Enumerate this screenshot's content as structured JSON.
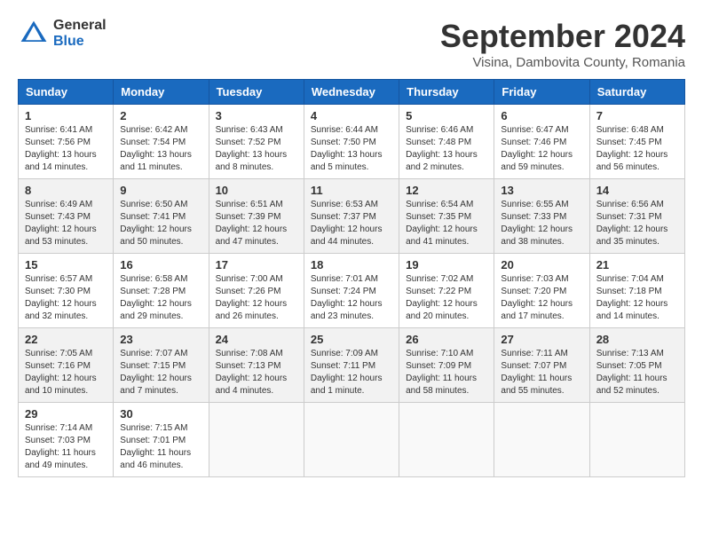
{
  "header": {
    "logo_general": "General",
    "logo_blue": "Blue",
    "title": "September 2024",
    "subtitle": "Visina, Dambovita County, Romania"
  },
  "days_of_week": [
    "Sunday",
    "Monday",
    "Tuesday",
    "Wednesday",
    "Thursday",
    "Friday",
    "Saturday"
  ],
  "weeks": [
    [
      {
        "day": "1",
        "text": "Sunrise: 6:41 AM\nSunset: 7:56 PM\nDaylight: 13 hours and 14 minutes."
      },
      {
        "day": "2",
        "text": "Sunrise: 6:42 AM\nSunset: 7:54 PM\nDaylight: 13 hours and 11 minutes."
      },
      {
        "day": "3",
        "text": "Sunrise: 6:43 AM\nSunset: 7:52 PM\nDaylight: 13 hours and 8 minutes."
      },
      {
        "day": "4",
        "text": "Sunrise: 6:44 AM\nSunset: 7:50 PM\nDaylight: 13 hours and 5 minutes."
      },
      {
        "day": "5",
        "text": "Sunrise: 6:46 AM\nSunset: 7:48 PM\nDaylight: 13 hours and 2 minutes."
      },
      {
        "day": "6",
        "text": "Sunrise: 6:47 AM\nSunset: 7:46 PM\nDaylight: 12 hours and 59 minutes."
      },
      {
        "day": "7",
        "text": "Sunrise: 6:48 AM\nSunset: 7:45 PM\nDaylight: 12 hours and 56 minutes."
      }
    ],
    [
      {
        "day": "8",
        "text": "Sunrise: 6:49 AM\nSunset: 7:43 PM\nDaylight: 12 hours and 53 minutes."
      },
      {
        "day": "9",
        "text": "Sunrise: 6:50 AM\nSunset: 7:41 PM\nDaylight: 12 hours and 50 minutes."
      },
      {
        "day": "10",
        "text": "Sunrise: 6:51 AM\nSunset: 7:39 PM\nDaylight: 12 hours and 47 minutes."
      },
      {
        "day": "11",
        "text": "Sunrise: 6:53 AM\nSunset: 7:37 PM\nDaylight: 12 hours and 44 minutes."
      },
      {
        "day": "12",
        "text": "Sunrise: 6:54 AM\nSunset: 7:35 PM\nDaylight: 12 hours and 41 minutes."
      },
      {
        "day": "13",
        "text": "Sunrise: 6:55 AM\nSunset: 7:33 PM\nDaylight: 12 hours and 38 minutes."
      },
      {
        "day": "14",
        "text": "Sunrise: 6:56 AM\nSunset: 7:31 PM\nDaylight: 12 hours and 35 minutes."
      }
    ],
    [
      {
        "day": "15",
        "text": "Sunrise: 6:57 AM\nSunset: 7:30 PM\nDaylight: 12 hours and 32 minutes."
      },
      {
        "day": "16",
        "text": "Sunrise: 6:58 AM\nSunset: 7:28 PM\nDaylight: 12 hours and 29 minutes."
      },
      {
        "day": "17",
        "text": "Sunrise: 7:00 AM\nSunset: 7:26 PM\nDaylight: 12 hours and 26 minutes."
      },
      {
        "day": "18",
        "text": "Sunrise: 7:01 AM\nSunset: 7:24 PM\nDaylight: 12 hours and 23 minutes."
      },
      {
        "day": "19",
        "text": "Sunrise: 7:02 AM\nSunset: 7:22 PM\nDaylight: 12 hours and 20 minutes."
      },
      {
        "day": "20",
        "text": "Sunrise: 7:03 AM\nSunset: 7:20 PM\nDaylight: 12 hours and 17 minutes."
      },
      {
        "day": "21",
        "text": "Sunrise: 7:04 AM\nSunset: 7:18 PM\nDaylight: 12 hours and 14 minutes."
      }
    ],
    [
      {
        "day": "22",
        "text": "Sunrise: 7:05 AM\nSunset: 7:16 PM\nDaylight: 12 hours and 10 minutes."
      },
      {
        "day": "23",
        "text": "Sunrise: 7:07 AM\nSunset: 7:15 PM\nDaylight: 12 hours and 7 minutes."
      },
      {
        "day": "24",
        "text": "Sunrise: 7:08 AM\nSunset: 7:13 PM\nDaylight: 12 hours and 4 minutes."
      },
      {
        "day": "25",
        "text": "Sunrise: 7:09 AM\nSunset: 7:11 PM\nDaylight: 12 hours and 1 minute."
      },
      {
        "day": "26",
        "text": "Sunrise: 7:10 AM\nSunset: 7:09 PM\nDaylight: 11 hours and 58 minutes."
      },
      {
        "day": "27",
        "text": "Sunrise: 7:11 AM\nSunset: 7:07 PM\nDaylight: 11 hours and 55 minutes."
      },
      {
        "day": "28",
        "text": "Sunrise: 7:13 AM\nSunset: 7:05 PM\nDaylight: 11 hours and 52 minutes."
      }
    ],
    [
      {
        "day": "29",
        "text": "Sunrise: 7:14 AM\nSunset: 7:03 PM\nDaylight: 11 hours and 49 minutes."
      },
      {
        "day": "30",
        "text": "Sunrise: 7:15 AM\nSunset: 7:01 PM\nDaylight: 11 hours and 46 minutes."
      },
      {
        "day": "",
        "text": ""
      },
      {
        "day": "",
        "text": ""
      },
      {
        "day": "",
        "text": ""
      },
      {
        "day": "",
        "text": ""
      },
      {
        "day": "",
        "text": ""
      }
    ]
  ]
}
